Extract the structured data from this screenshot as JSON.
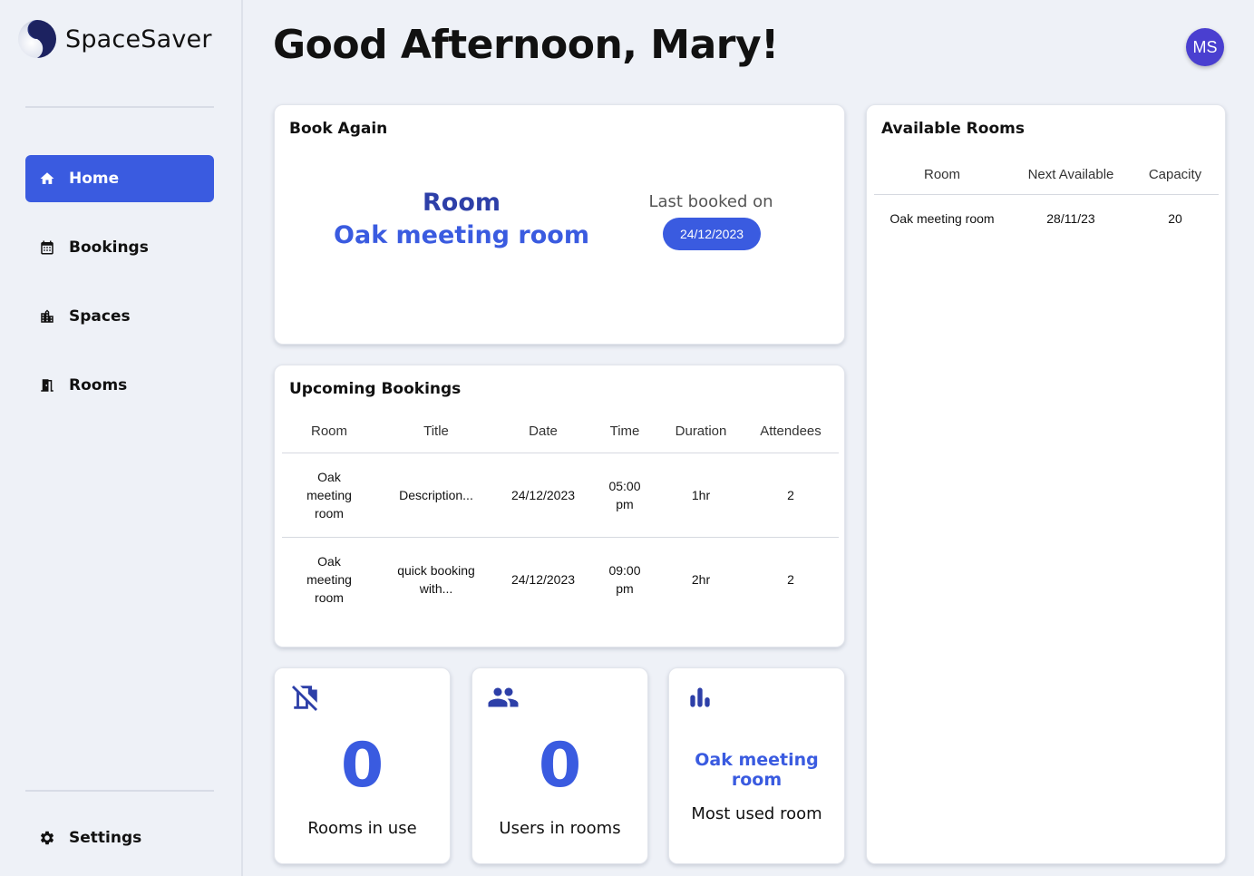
{
  "app": {
    "name": "SpaceSaver"
  },
  "sidebar": {
    "items": [
      {
        "label": "Home",
        "icon": "home-icon",
        "active": true
      },
      {
        "label": "Bookings",
        "icon": "calendar-icon"
      },
      {
        "label": "Spaces",
        "icon": "building-icon"
      },
      {
        "label": "Rooms",
        "icon": "door-icon"
      }
    ],
    "settings": {
      "label": "Settings",
      "icon": "gear-icon"
    }
  },
  "header": {
    "greeting": "Good Afternoon, Mary!",
    "avatar_initials": "MS"
  },
  "book_again": {
    "title": "Book Again",
    "room_heading": "Room",
    "room_name": "Oak meeting room",
    "last_booked_label": "Last booked on",
    "last_booked_date": "24/12/2023"
  },
  "upcoming_bookings": {
    "title": "Upcoming Bookings",
    "columns": [
      "Room",
      "Title",
      "Date",
      "Time",
      "Duration",
      "Attendees"
    ],
    "rows": [
      {
        "room": "Oak meeting room",
        "title": "Description...",
        "date": "24/12/2023",
        "time": "05:00 pm",
        "duration": "1hr",
        "attendees": "2"
      },
      {
        "room": "Oak meeting room",
        "title": "quick booking with...",
        "date": "24/12/2023",
        "time": "09:00 pm",
        "duration": "2hr",
        "attendees": "2"
      }
    ]
  },
  "available_rooms": {
    "title": "Available Rooms",
    "columns": [
      "Room",
      "Next Available",
      "Capacity"
    ],
    "rows": [
      {
        "room": "Oak meeting room",
        "next_available": "28/11/23",
        "capacity": "20"
      }
    ]
  },
  "stats": {
    "rooms_in_use": {
      "value": "0",
      "label": "Rooms in use",
      "icon": "room-off-icon"
    },
    "users_in_rooms": {
      "value": "0",
      "label": "Users in rooms",
      "icon": "users-icon"
    },
    "most_used_room": {
      "value": "Oak meeting room",
      "label": "Most used room",
      "icon": "bar-chart-icon"
    }
  },
  "colors": {
    "accent": "#3a5be0",
    "avatar": "#4a3fd0",
    "background": "#eef1f7"
  }
}
